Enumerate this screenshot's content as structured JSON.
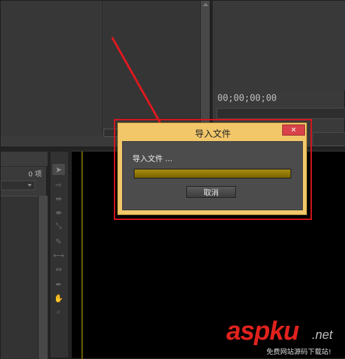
{
  "import_dialog": {
    "title": "导入文件",
    "message": "导入文件 ...",
    "progress": 1.0,
    "cancel_label": "取消",
    "close_glyph": "✕"
  },
  "program_monitor": {
    "timecode": "00;00;00;00"
  },
  "project_panel": {
    "item_count": "0 项"
  },
  "watermark": {
    "brand": "aspku",
    "tld": ".net",
    "tagline": "免费网站源码下载站!"
  },
  "colors": {
    "dialog_frame": "#f2c76a",
    "dialog_body": "#4c4c4c",
    "progress_fill": "#8d7300",
    "close_button": "#d9434a",
    "annotation_red": "#e3181f"
  },
  "icons": {
    "tools": [
      "selection-tool-icon",
      "track-select-icon",
      "ripple-edit-icon",
      "rolling-edit-icon",
      "rate-stretch-icon",
      "razor-icon",
      "slip-icon",
      "slide-icon",
      "pen-icon",
      "hand-icon",
      "zoom-icon"
    ]
  }
}
